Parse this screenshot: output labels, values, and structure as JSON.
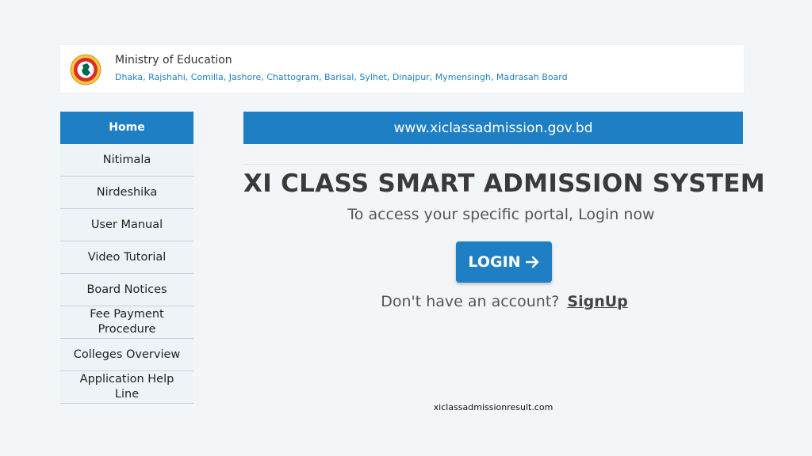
{
  "header": {
    "title": "Ministry of Education",
    "boards": "Dhaka, Rajshahi, Comilla, Jashore, Chattogram, Barisal, Sylhet, Dinajpur, Mymensingh, Madrasah Board"
  },
  "sidebar": {
    "items": [
      {
        "label": "Home",
        "active": true
      },
      {
        "label": "Nitimala"
      },
      {
        "label": "Nirdeshika"
      },
      {
        "label": "User Manual"
      },
      {
        "label": "Video Tutorial"
      },
      {
        "label": "Board Notices"
      },
      {
        "label": "Fee Payment Procedure"
      },
      {
        "label": "Colleges Overview"
      },
      {
        "label": "Application Help Line"
      }
    ]
  },
  "main": {
    "url_banner": "www.xiclassadmission.gov.bd",
    "title": "XI CLASS SMART ADMISSION SYSTEM",
    "subtitle": "To access your specific portal, Login now",
    "login_label": "LOGIN",
    "signup_prompt": "Don't have an account?",
    "signup_label": "SignUp"
  },
  "watermark": "xiclassadmissionresult.com",
  "colors": {
    "accent": "#1e7fc4",
    "background": "#f3f6f9",
    "logo_red": "#e02828",
    "logo_green": "#006a4e"
  },
  "icons": {
    "logo": "government-seal-icon",
    "login_arrow": "arrow-right-icon"
  }
}
